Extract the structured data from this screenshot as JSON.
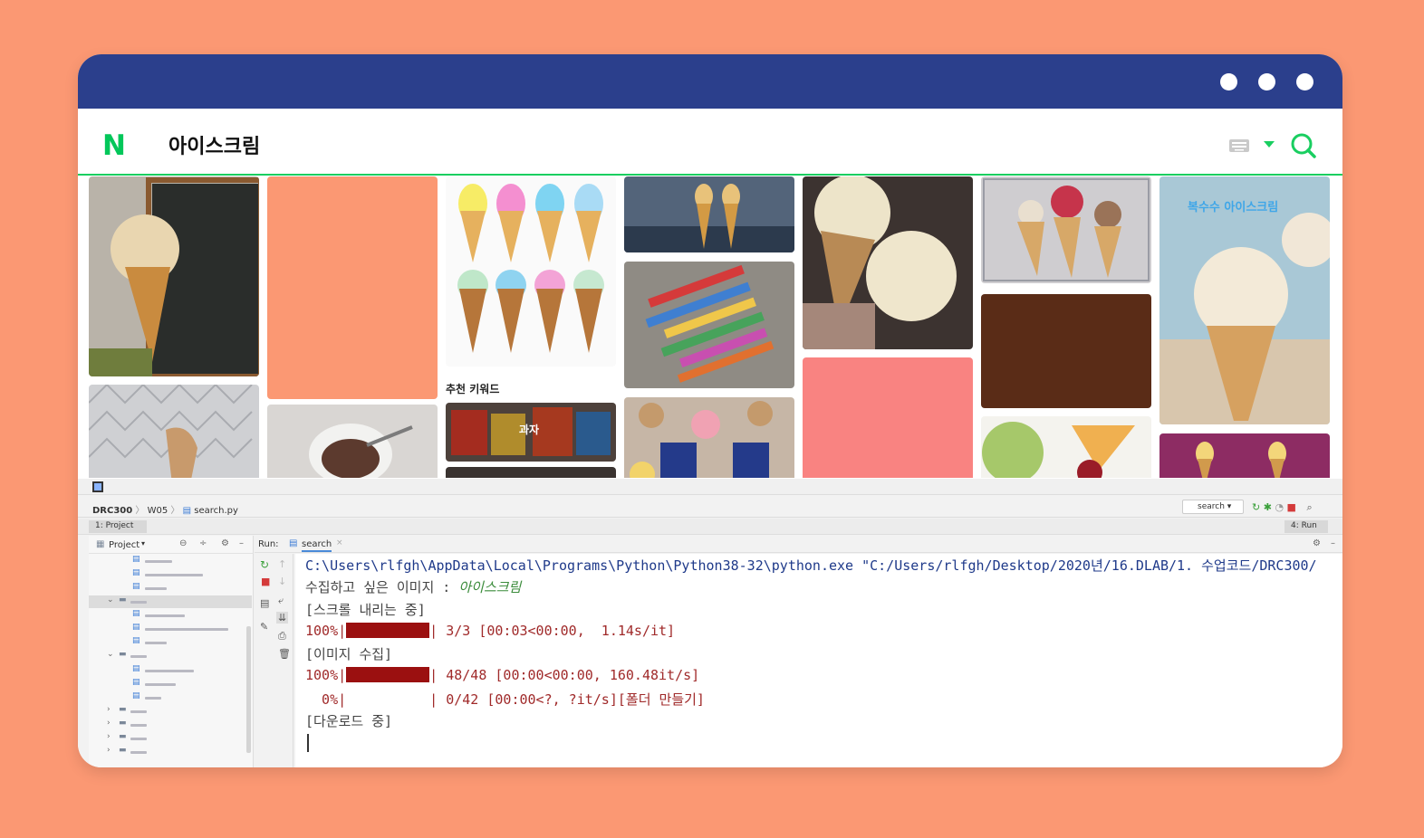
{
  "browser": {
    "logo": "N",
    "query": "아이스크림",
    "recommended_label": "추천 키워드",
    "snack_keyword": "과자",
    "bokbok_text": "복수수 아이스크림"
  },
  "ide": {
    "breadcrumb": [
      "DRC300",
      "W05",
      "search.py"
    ],
    "run_config": "search",
    "project_tab": "1: Project",
    "run_tab_right": "4: Run",
    "project_header": "Project",
    "run_label": "Run:",
    "run_tab_name": "search",
    "console": {
      "cmd_line": "C:\\Users\\rlfgh\\AppData\\Local\\Programs\\Python\\Python38-32\\python.exe \"C:/Users/rlfgh/Desktop/2020년/16.DLAB/1. 수업코드/DRC300/",
      "prompt_label": "수집하고 싶은 이미지 : ",
      "prompt_value": "아이스크림",
      "scroll_status": "[스크롤 내리는 중]",
      "progress1_pct": "100%|",
      "progress1_tail": "| 3/3 [00:03<00:00,  1.14s/it]",
      "collect_status": "[이미지 수집]",
      "progress2_pct": "100%|",
      "progress2_tail": "| 48/48 [00:00<00:00, 160.48it/s]",
      "progress3_pct": "  0%|",
      "progress3_tail": "| 0/42 [00:00<?, ?it/s][폴더 만들기]",
      "download_status": "[다운로드 중]"
    }
  },
  "colors": {
    "background": "#fb9873",
    "titlebar": "#2b3f8c",
    "naver_green": "#03c75a",
    "progress_fill": "#9b1010"
  },
  "icons": [
    "dot-icon",
    "keyboard-icon",
    "search-icon",
    "folder-icon",
    "python-file-icon",
    "rerun-icon",
    "stop-icon",
    "settings-icon"
  ]
}
